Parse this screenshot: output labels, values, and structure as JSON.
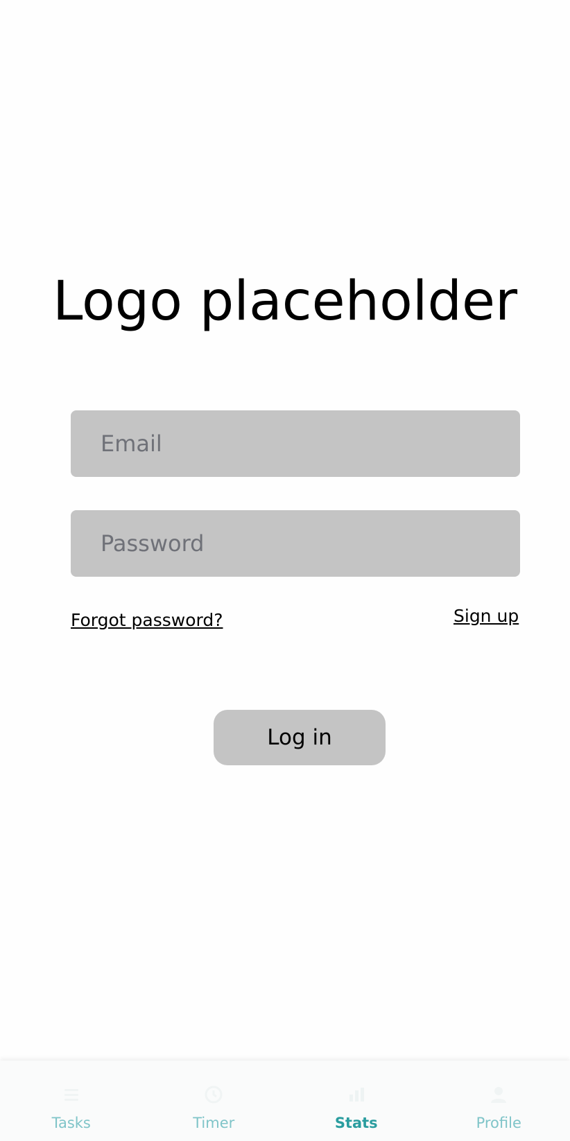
{
  "logo": {
    "text": "Logo placeholder"
  },
  "form": {
    "email_placeholder": "Email",
    "password_placeholder": "Password",
    "forgot_label": "Forgot password?",
    "signup_label": "Sign up",
    "login_label": "Log in"
  },
  "tabbar": {
    "active": "Stats",
    "accent_color": "#2a9d9f",
    "inactive_color": "#7fc4c8",
    "items": [
      {
        "label": "Tasks",
        "icon": "list-icon"
      },
      {
        "label": "Timer",
        "icon": "clock-icon"
      },
      {
        "label": "Stats",
        "icon": "chart-icon"
      },
      {
        "label": "Profile",
        "icon": "person-icon"
      }
    ]
  }
}
